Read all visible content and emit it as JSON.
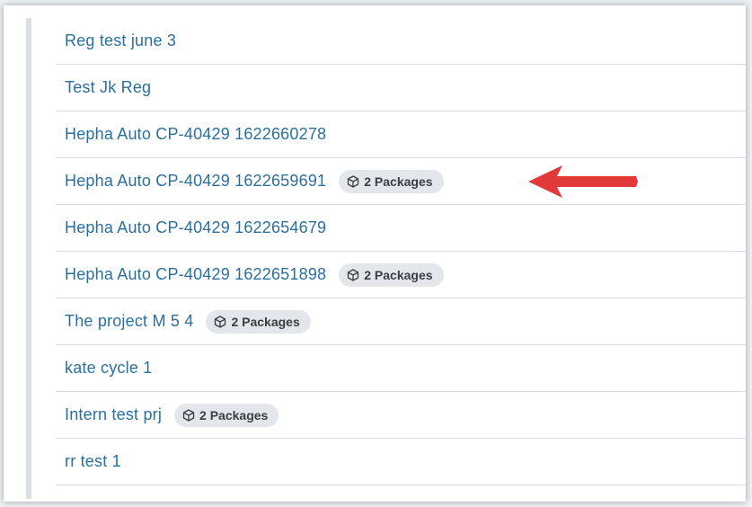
{
  "projects": [
    {
      "title": "Reg test june 3",
      "badge": ""
    },
    {
      "title": "Test Jk Reg",
      "badge": ""
    },
    {
      "title": "Hepha Auto CP-40429 1622660278",
      "badge": ""
    },
    {
      "title": "Hepha Auto CP-40429 1622659691",
      "badge": "2 Packages"
    },
    {
      "title": "Hepha Auto CP-40429 1622654679",
      "badge": ""
    },
    {
      "title": "Hepha Auto CP-40429 1622651898",
      "badge": "2 Packages"
    },
    {
      "title": "The project M 5 4",
      "badge": "2 Packages"
    },
    {
      "title": "kate cycle 1",
      "badge": ""
    },
    {
      "title": "Intern test prj",
      "badge": "2 Packages"
    },
    {
      "title": "rr test 1",
      "badge": ""
    }
  ],
  "badge_icon": "package-icon",
  "annotation": {
    "icon": "red-arrow-icon",
    "color": "#e23a3a",
    "points_to_row": 3
  },
  "colors": {
    "link": "#2b6f9e",
    "badge_bg": "#e3e6ea",
    "divider": "#d9dde2"
  }
}
